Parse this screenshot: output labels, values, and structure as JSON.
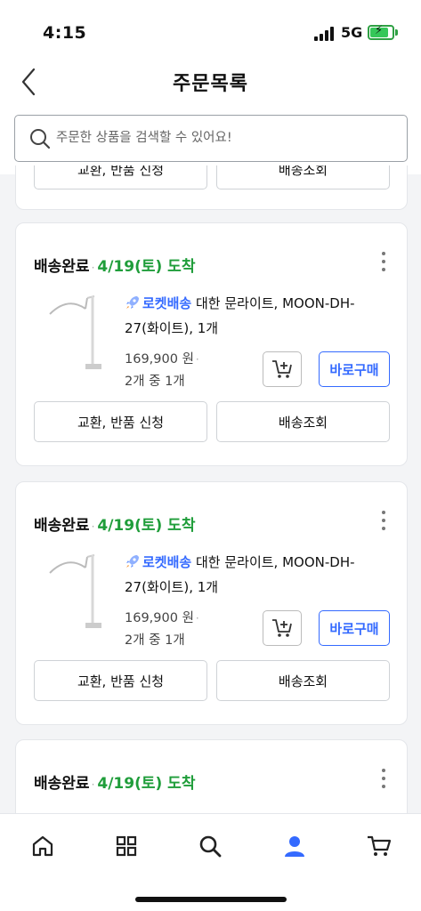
{
  "status_bar": {
    "time": "4:15",
    "network": "5G"
  },
  "header": {
    "title": "주문목록"
  },
  "search": {
    "placeholder": "주문한 상품을 검색할 수 있어요!"
  },
  "partial_card": {
    "left_action": "교환, 반품 신청",
    "right_action": "배송조회"
  },
  "orders": [
    {
      "status": "배송완료",
      "arrival": "4/19(토) 도착",
      "badge": "로켓배송",
      "title": "대한 문라이트, MOON-DH-27(화이트), 1개",
      "price": "169,900 원",
      "qty": "2개 중 1개",
      "buy_label": "바로구매",
      "left_action": "교환, 반품 신청",
      "right_action": "배송조회"
    },
    {
      "status": "배송완료",
      "arrival": "4/19(토) 도착",
      "badge": "로켓배송",
      "title": "대한 문라이트, MOON-DH-27(화이트), 1개",
      "price": "169,900 원",
      "qty": "2개 중 1개",
      "buy_label": "바로구매",
      "left_action": "교환, 반품 신청",
      "right_action": "배송조회"
    },
    {
      "status": "배송완료",
      "arrival": "4/19(토) 도착"
    }
  ],
  "tabbar": {
    "items": [
      {
        "icon": "home-icon"
      },
      {
        "icon": "category-grid-icon"
      },
      {
        "icon": "search-icon"
      },
      {
        "icon": "my-profile-icon",
        "active": true
      },
      {
        "icon": "cart-icon"
      }
    ]
  },
  "colors": {
    "accent": "#346aff",
    "arrival": "#1f9d3a",
    "active_tab": "#346aff"
  }
}
